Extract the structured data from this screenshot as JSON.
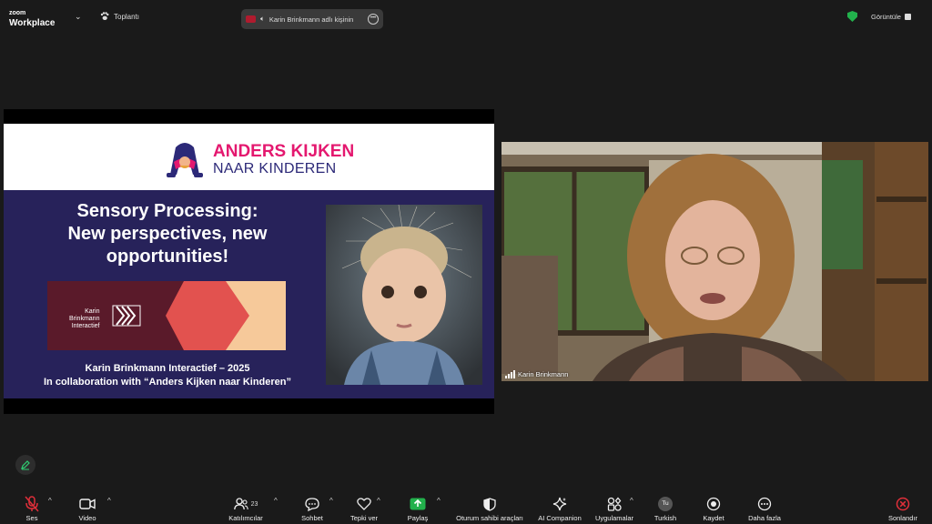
{
  "app": {
    "brand_small": "zoom",
    "brand_main": "Workplace"
  },
  "header": {
    "meeting_label": "Toplantı",
    "speaker_pill": "Karin Brinkmann adlı kişinin",
    "view_label": "Görüntüle"
  },
  "slide": {
    "logo_line1": "ANDERS KIJKEN",
    "logo_line2": "NAAR KINDEREN",
    "title_lines": [
      "Sensory Processing:",
      "New perspectives, new",
      "opportunities!"
    ],
    "kb_lines": [
      "Karin",
      "Brinkmann",
      "Interactief"
    ],
    "footer_line1": "Karin Brinkmann Interactief – 2025",
    "footer_line2": "In collaboration with “Anders Kijken naar Kinderen”"
  },
  "video": {
    "participant_name": "Karin Brinkmann"
  },
  "toolbar": {
    "audio": "Ses",
    "video": "Video",
    "participants": "Katılımcılar",
    "participants_count": "23",
    "chat": "Sohbet",
    "react": "Tepki ver",
    "share": "Paylaş",
    "host_tools": "Oturum sahibi araçları",
    "ai": "AI Companion",
    "apps": "Uygulamalar",
    "language_badge": "Tu",
    "language": "Turkish",
    "record": "Kaydet",
    "more": "Daha fazla",
    "end": "Sonlandır"
  },
  "colors": {
    "background": "#1a1a1a",
    "slide_bg": "#27225a",
    "logo_pink": "#e4186f",
    "logo_navy": "#2c2978",
    "share_green": "#22b14c",
    "end_red": "#e02f3a",
    "mute_red": "#e02f3a"
  }
}
